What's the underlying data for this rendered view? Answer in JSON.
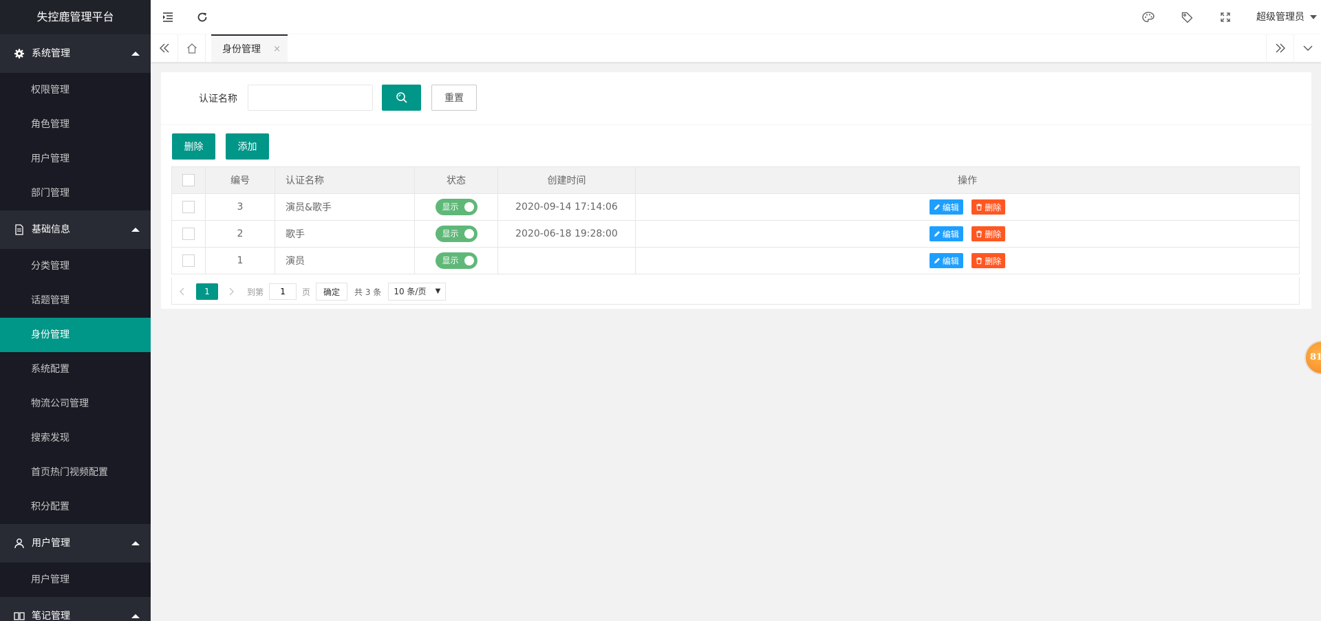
{
  "app": {
    "title": "失控鹿管理平台"
  },
  "sidebar": {
    "groups": [
      {
        "title": "系统管理",
        "icon": "gear-icon",
        "items": [
          "权限管理",
          "角色管理",
          "用户管理",
          "部门管理"
        ]
      },
      {
        "title": "基础信息",
        "icon": "document-icon",
        "items": [
          "分类管理",
          "话题管理",
          "身份管理",
          "系统配置",
          "物流公司管理",
          "搜索发现",
          "首页热门视频配置",
          "积分配置"
        ]
      },
      {
        "title": "用户管理",
        "icon": "user-icon",
        "items": [
          "用户管理"
        ]
      },
      {
        "title": "笔记管理",
        "icon": "notes-icon",
        "items": []
      }
    ],
    "active_item": "身份管理"
  },
  "header": {
    "user_name": "超级管理员",
    "icons": [
      "menu-fold-icon",
      "refresh-icon",
      "theme-icon",
      "tag-icon",
      "fullscreen-icon"
    ]
  },
  "tabs": {
    "items": [
      {
        "label": "身份管理",
        "close": "×"
      }
    ]
  },
  "search": {
    "label": "认证名称",
    "input_value": "",
    "placeholder": "",
    "reset_label": "重置"
  },
  "toolbar": {
    "delete_label": "删除",
    "add_label": "添加"
  },
  "table": {
    "headers": [
      "编号",
      "认证名称",
      "状态",
      "创建时间",
      "操作"
    ],
    "rows": [
      {
        "id": "3",
        "name": "演员&歌手",
        "status": "显示",
        "created": "2020-09-14 17:14:06"
      },
      {
        "id": "2",
        "name": "歌手",
        "status": "显示",
        "created": "2020-06-18 19:28:00"
      },
      {
        "id": "1",
        "name": "演员",
        "status": "显示",
        "created": ""
      }
    ],
    "edit_label": "编辑",
    "delete_label": "删除"
  },
  "pagination": {
    "current_page": "1",
    "goto_label": "到第",
    "goto_value": "1",
    "page_label": "页",
    "confirm_label": "确定",
    "total_label": "共 3 条",
    "page_size_label": "10 条/页"
  },
  "float_badge": {
    "text": "81"
  },
  "colors": {
    "sidebar_bg": "#20222a",
    "accent": "#009688",
    "switch_on": "#5fb878",
    "edit": "#1e9fff",
    "danger": "#ff5722"
  }
}
